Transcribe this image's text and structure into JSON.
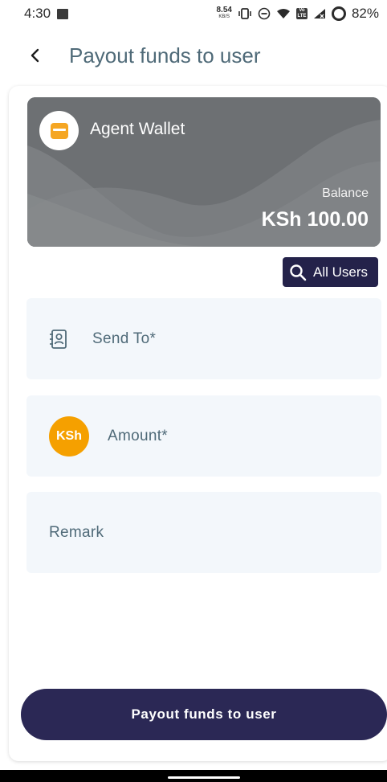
{
  "status_bar": {
    "time": "4:30",
    "net_speed_value": "8.54",
    "net_speed_unit": "KB/S",
    "lte_label": "Vo LTE",
    "battery": "82%"
  },
  "app_bar": {
    "back_icon": "chevron-left-icon",
    "title": "Payout funds to user"
  },
  "wallet": {
    "name": "Agent Wallet",
    "icon": "wallet-icon",
    "balance_label": "Balance",
    "balance_value": "KSh 100.00"
  },
  "all_users_button": {
    "icon": "search-icon",
    "label": "All Users"
  },
  "form": {
    "send_to": {
      "icon": "contacts-icon",
      "label": "Send To*"
    },
    "amount": {
      "badge": "KSh",
      "label": "Amount*"
    },
    "remark": {
      "label": "Remark"
    }
  },
  "submit_button": {
    "label": "Payout funds to user"
  },
  "colors": {
    "primary": "#2b2855",
    "accent": "#f5a000",
    "field_bg": "#f3f7fb",
    "label_text": "#4f6a78",
    "card_bg": "#6b6e71"
  }
}
